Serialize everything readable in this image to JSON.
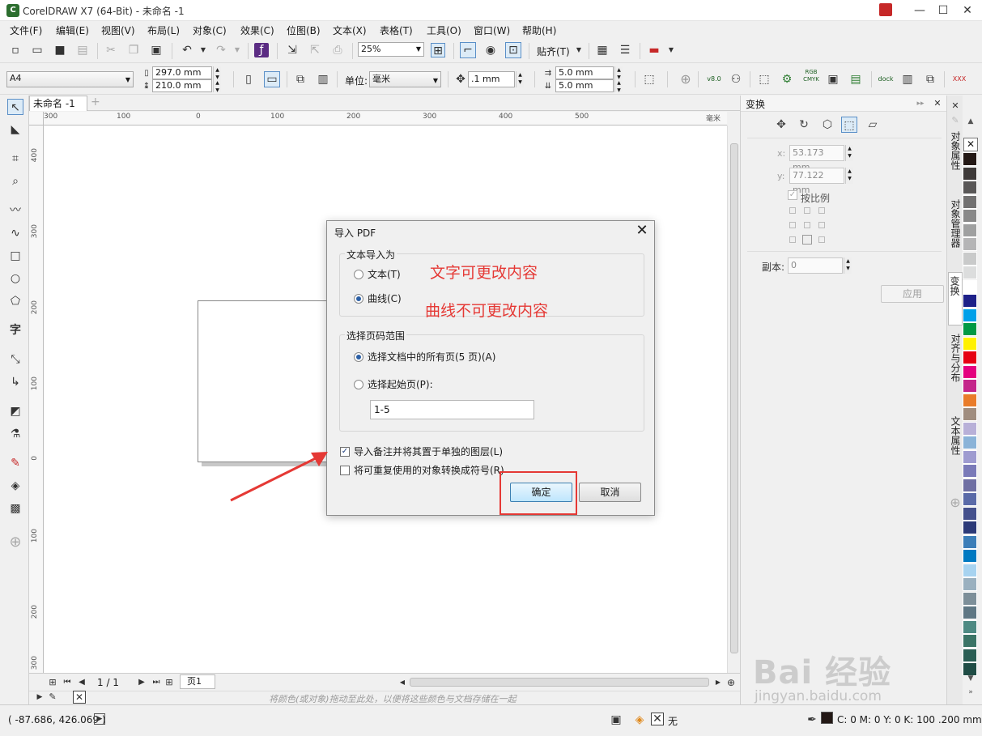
{
  "window": {
    "title": "CorelDRAW X7 (64-Bit) - 未命名 -1",
    "minimize": "—",
    "maximize": "☐",
    "close": "✕"
  },
  "menu": [
    "文件(F)",
    "编辑(E)",
    "视图(V)",
    "布局(L)",
    "对象(C)",
    "效果(C)",
    "位图(B)",
    "文本(X)",
    "表格(T)",
    "工具(O)",
    "窗口(W)",
    "帮助(H)"
  ],
  "toolbar1": {
    "zoom": "25%",
    "snap_label": "贴齐(T)"
  },
  "toolbar2": {
    "page_size": "A4",
    "width": "297.0 mm",
    "height": "210.0 mm",
    "units_label": "单位:",
    "units": "毫米",
    "nudge": ".1 mm",
    "dup_x": "5.0 mm",
    "dup_y": "5.0 mm",
    "v8_label": "v8.0",
    "rgb_label": "RGB",
    "cmyk_label": "CMYK",
    "dock_label": "dock",
    "xxx_label": "XXX"
  },
  "doc_tab": "未命名 -1",
  "ruler_h": [
    "300",
    "100",
    "0",
    "100",
    "200",
    "300",
    "400",
    "500",
    "毫米"
  ],
  "ruler_v": [
    "400",
    "300",
    "200",
    "100",
    "0",
    "100",
    "200",
    "300"
  ],
  "page_nav": {
    "page_counter": "1 / 1",
    "page_tab": "页1"
  },
  "palette_hint": "将颜色(或对象)拖动至此处，以便将这些颜色与文档存储在一起",
  "status": {
    "coords": "( -87.686, 426.069 )",
    "fill": "无",
    "outline": "C: 0 M: 0 Y: 0 K: 100  .200 mm"
  },
  "docker": {
    "title": "变换",
    "x_label": "x:",
    "x_value": "53.173 mm",
    "y_label": "y:",
    "y_value": "77.122 mm",
    "proportional": "按比例",
    "copies_label": "副本:",
    "copies_value": "0",
    "apply": "应用"
  },
  "docker_tabs": [
    "对象属性",
    "对象管理器",
    "变换",
    "对齐与分布",
    "文本属性"
  ],
  "palette_colors": [
    "#231815",
    "#3e3a39",
    "#595757",
    "#727171",
    "#898989",
    "#9fa0a0",
    "#b5b5b6",
    "#c9caca",
    "#dcdddd",
    "#ffffff",
    "#1d2088",
    "#00a0e9",
    "#009944",
    "#fff100",
    "#e60012",
    "#e4007f",
    "#c4258a",
    "#e97c2a",
    "#a08d7f",
    "#b8b0d8",
    "#8ab3d8",
    "#9e9bd0",
    "#7a7ab8",
    "#6f6fa3",
    "#5a6aa8",
    "#44508c",
    "#2c3a78",
    "#3c7eb8",
    "#0079c1",
    "#a7d3f0",
    "#9ab0bf",
    "#7d8f99",
    "#5f7784",
    "#4e8a83",
    "#3b7466",
    "#2a5e54",
    "#1f4c45"
  ],
  "dialog": {
    "title": "导入 PDF",
    "close": "✕",
    "group1_title": "文本导入为",
    "opt_text": "文本(T)",
    "opt_curves": "曲线(C)",
    "group2_title": "选择页码范围",
    "opt_all_pages": "选择文档中的所有页(5 页)(A)",
    "opt_start_page": "选择起始页(P):",
    "range_value": "1-5",
    "check_notes": "导入备注并将其置于单独的图层(L)",
    "check_symbols": "将可重复使用的对象转换成符号(R)",
    "ok": "确定",
    "cancel": "取消"
  },
  "annotations": {
    "text_note": "文字可更改内容",
    "curve_note": "曲线不可更改内容"
  },
  "watermark": {
    "brand": "Bai 经验",
    "url": "jingyan.baidu.com"
  }
}
